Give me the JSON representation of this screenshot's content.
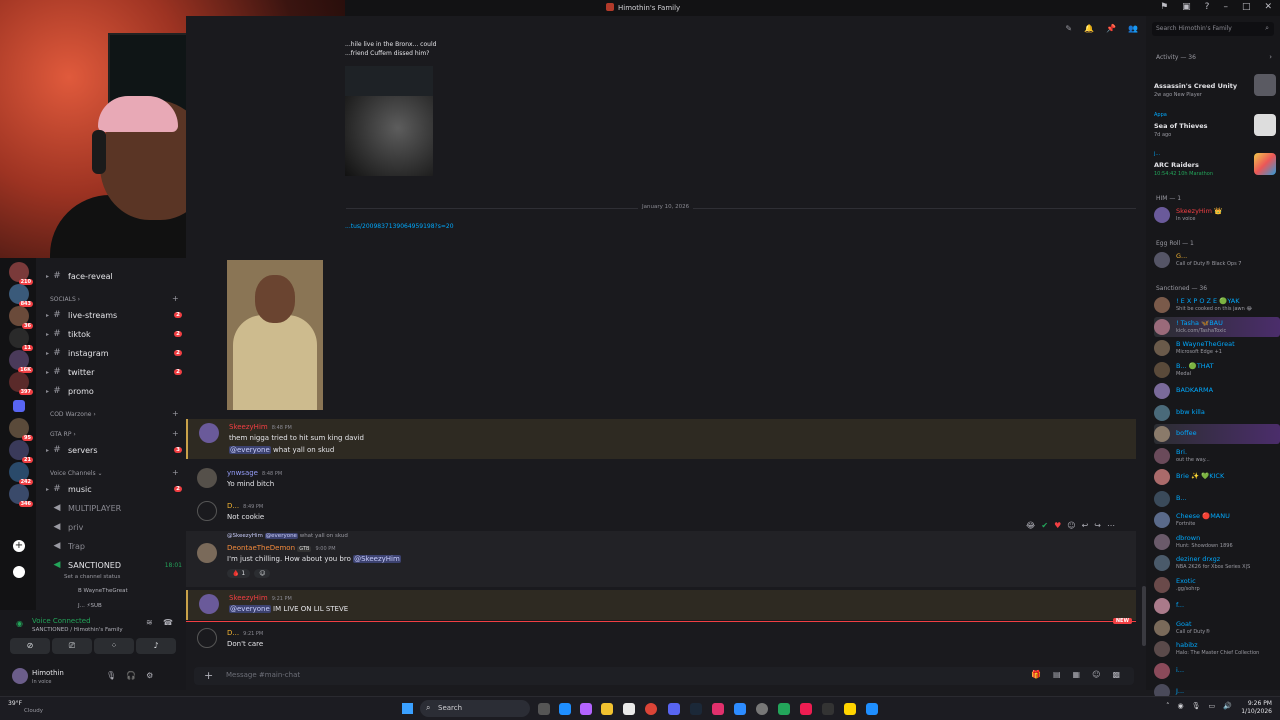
{
  "window": {
    "title": "Himothin's Family"
  },
  "colors": {
    "accent": "#5865f2",
    "danger": "#f23f43",
    "online": "#23a55a",
    "mention_bg": "#3c4270",
    "link": "#00a8fc",
    "highlight_border": "#c9a24a"
  },
  "server_rail": {
    "badges": [
      "210",
      "843",
      "36",
      "11",
      "16K",
      "397",
      "95",
      "21",
      "242",
      "346"
    ]
  },
  "channels": {
    "items": [
      {
        "name": "face-reveal",
        "badge": ""
      },
      {
        "category": "SOCIALS"
      },
      {
        "name": "live-streams",
        "badge": "2"
      },
      {
        "name": "tiktok",
        "badge": "2"
      },
      {
        "name": "instagram",
        "badge": "2"
      },
      {
        "name": "twitter",
        "badge": "2"
      },
      {
        "name": "promo",
        "badge": ""
      },
      {
        "category": "COD Warzone"
      },
      {
        "category": "GTA RP"
      },
      {
        "name": "servers",
        "badge": "3"
      },
      {
        "category": "Voice Channels"
      },
      {
        "name": "music",
        "badge": "2"
      },
      {
        "name": "MULTIPLAYER",
        "badge": ""
      },
      {
        "name": "priv",
        "badge": ""
      },
      {
        "name": "Trap",
        "badge": ""
      },
      {
        "name": "SANCTIONED",
        "timer": "18:01"
      }
    ],
    "channel_status_hint": "Set a channel status",
    "voice_members": [
      "B WayneTheGreat",
      "J... ⚡SUB"
    ]
  },
  "voice": {
    "connected_label": "Voice Connected",
    "location": "SANCTIONED / Himothin's Family",
    "user": {
      "name": "Himothin",
      "status": "In voice"
    }
  },
  "chat": {
    "header_icons": [
      "threads-icon",
      "bell-icon",
      "pin-icon",
      "members-icon"
    ],
    "top_caption": "...hile live in the Bronx... could ...friend Cuffem dissed him?",
    "date_separator": "January 10, 2026",
    "link_text": "...tus/2009837139064959198?s=20",
    "messages": [
      {
        "author": "SkeezyHim",
        "time": "8:48 PM",
        "lines": [
          "them nigga tried to hit sum king david"
        ],
        "mention_line": "@everyone",
        "mention_rest": " what yall on skud"
      },
      {
        "author": "ynwsage",
        "time": "8:48 PM",
        "lines": [
          "Yo mind bitch"
        ]
      },
      {
        "author": "D...",
        "time": "8:49 PM",
        "lines": [
          "Not cookie"
        ]
      },
      {
        "author": "DeontaeTheDemon",
        "time": "9:00 PM",
        "reply_to": "@SkeezyHim",
        "reply_mention": "@everyone",
        "reply_text": " what yall on skud",
        "tag": "GTB",
        "lines": [
          "I'm just chilling. How about you bro "
        ],
        "inline_mention": "@SkeezyHim",
        "reaction_count": "1"
      },
      {
        "author": "SkeezyHim",
        "time": "9:21 PM",
        "mention_line": "@everyone",
        "mention_rest": " IM LIVE ON LIL STEVE"
      },
      {
        "author": "D...",
        "time": "9:21 PM",
        "lines": [
          "Don't care"
        ]
      }
    ],
    "new_badge": "NEW",
    "composer_placeholder": "Message #main-chat"
  },
  "members": {
    "search_placeholder": "Search Himothin's Family",
    "activity_header": "Activity — 36",
    "activities": [
      {
        "who": "",
        "game": "Assassin's Creed Unity",
        "meta": "2w ago  New Player"
      },
      {
        "who": "Appa",
        "game": "Sea of Thieves",
        "meta": "7d ago"
      },
      {
        "who": "j...",
        "game": "ARC Raiders",
        "meta": "10:54:42  10h Marathon"
      }
    ],
    "groups": [
      {
        "header": "HIM — 1",
        "members": [
          {
            "name": "SkeezyHim 👑",
            "status": "In voice",
            "color": "#f23f43"
          }
        ]
      },
      {
        "header": "Egg Roll — 1",
        "members": [
          {
            "name": "G...",
            "status": "Call of Duty® Black Ops 7",
            "color": "#f0b232"
          }
        ]
      },
      {
        "header": "Sanctioned — 36",
        "members": [
          {
            "name": "! E X P O Z E  🟢YAK",
            "status": "Shit be cooked on this jawn 😂",
            "color": "#00a8fc"
          },
          {
            "name": "! Tasha  🦋BAU",
            "status": "kick.com/TashaToxic",
            "color": "#00a8fc"
          },
          {
            "name": "B WayneTheGreat",
            "status": "Microsoft Edge +1",
            "color": "#00a8fc"
          },
          {
            "name": "B...  🟢THAT",
            "status": "Medal",
            "color": "#00a8fc"
          },
          {
            "name": "BADKARMA",
            "status": "",
            "color": "#00a8fc"
          },
          {
            "name": "bbw killa",
            "status": "",
            "color": "#00a8fc"
          },
          {
            "name": "boffee",
            "status": "",
            "color": "#00a8fc"
          },
          {
            "name": "Bri.",
            "status": "out the way...",
            "color": "#00a8fc"
          },
          {
            "name": "Brie ✨  💚KICK",
            "status": "",
            "color": "#00a8fc"
          },
          {
            "name": "B...",
            "status": "",
            "color": "#00a8fc"
          },
          {
            "name": "Cheese  🔴MANU",
            "status": "Fortnite",
            "color": "#00a8fc"
          },
          {
            "name": "dbrown",
            "status": "Hunt: Showdown 1896",
            "color": "#00a8fc"
          },
          {
            "name": "deziner drxgz",
            "status": "NBA 2K26 for Xbox Series X|S",
            "color": "#00a8fc"
          },
          {
            "name": "Exotic",
            "status": ".gg/sohrp",
            "color": "#00a8fc"
          },
          {
            "name": "f...",
            "status": "",
            "color": "#00a8fc"
          },
          {
            "name": "Goat",
            "status": "Call of Duty®",
            "color": "#00a8fc"
          },
          {
            "name": "habibz",
            "status": "Halo: The Master Chief Collection",
            "color": "#00a8fc"
          },
          {
            "name": "i...",
            "status": "",
            "color": "#00a8fc"
          },
          {
            "name": "J...",
            "status": "",
            "color": "#00a8fc"
          }
        ]
      }
    ]
  },
  "taskbar": {
    "weather_temp": "39°F",
    "weather_desc": "Cloudy",
    "search_label": "Search",
    "time": "9:26 PM",
    "date": "1/10/2026"
  }
}
